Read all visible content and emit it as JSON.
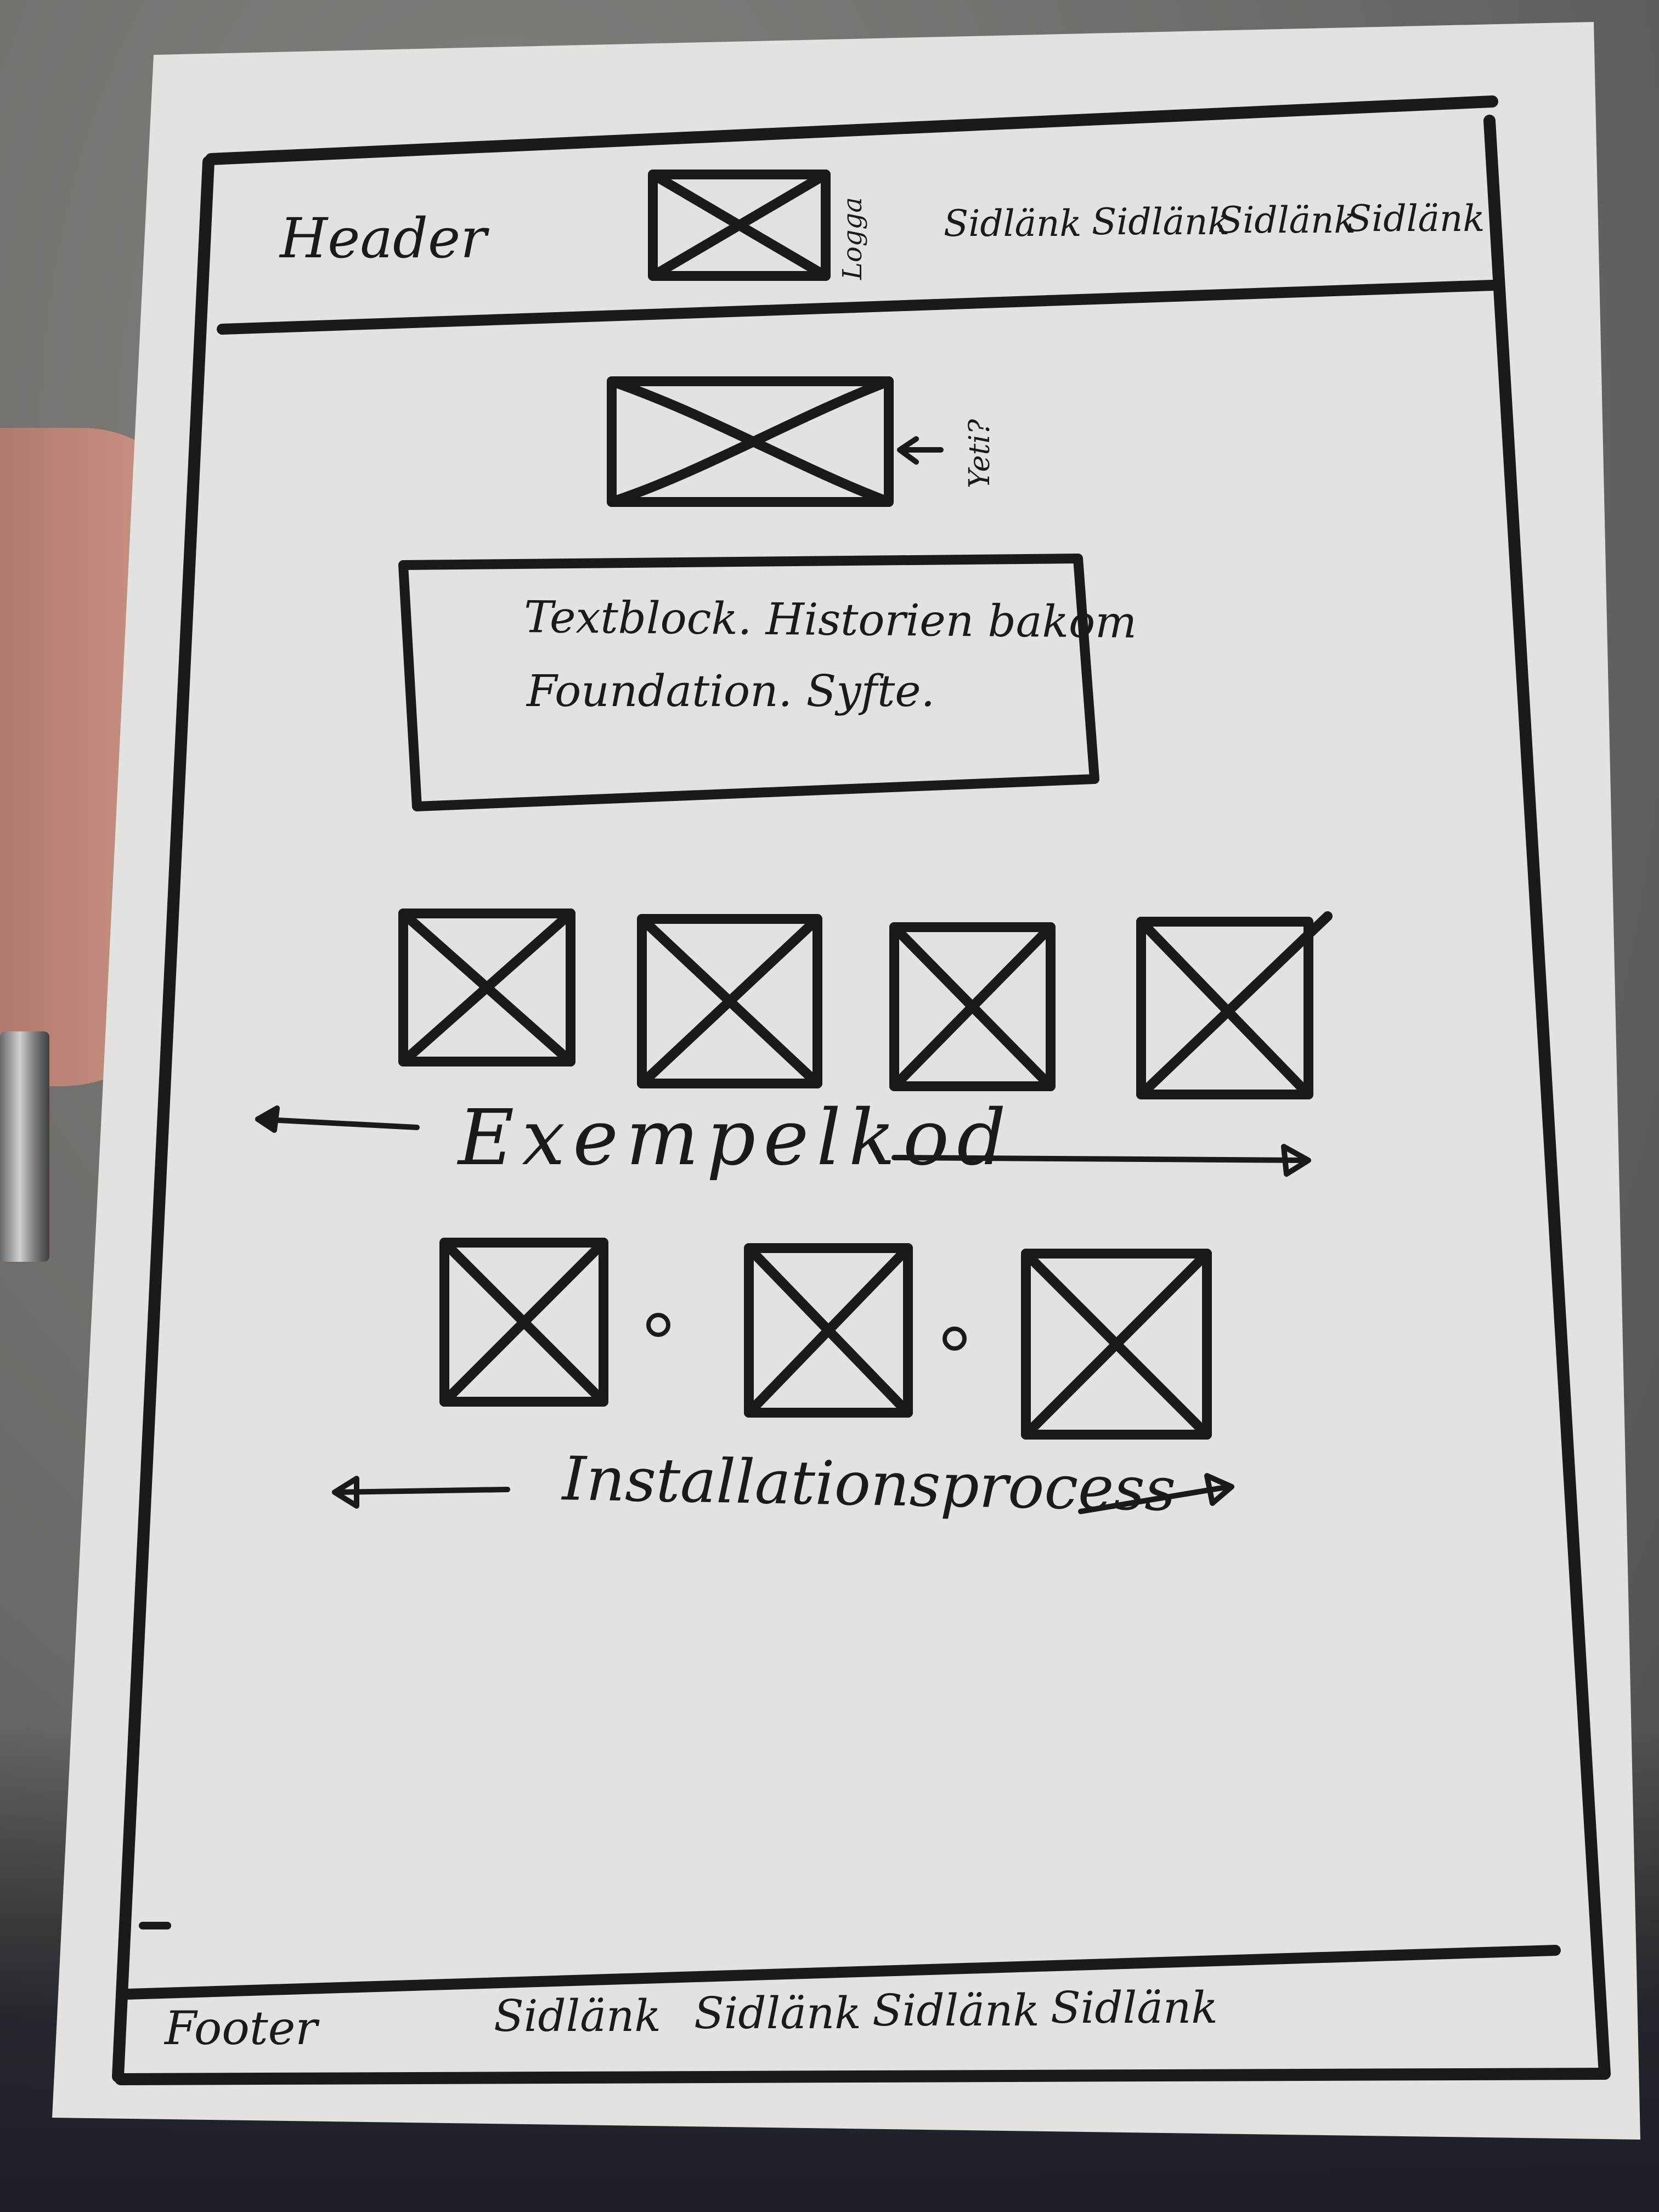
{
  "header": {
    "label": "Header",
    "logo_label": "Logga",
    "nav_links": [
      "Sidlänk",
      "Sidlänk",
      "Sidlänk",
      "Sidlänk"
    ]
  },
  "hero": {
    "image_note": "Yeti?"
  },
  "textblock": {
    "line1": "Textblock. Historien bakom",
    "line2": "Foundation. Syfte."
  },
  "examples": {
    "label": "Exempelkod"
  },
  "install": {
    "label": "Installationsprocess"
  },
  "footer": {
    "label": "Footer",
    "nav_links": [
      "Sidlänk",
      "Sidlänk",
      "Sidlänk",
      "Sidlänk"
    ]
  },
  "colors": {
    "paper": "#e4e2df",
    "ink": "#1b1a18",
    "background": "#6f6c69"
  }
}
